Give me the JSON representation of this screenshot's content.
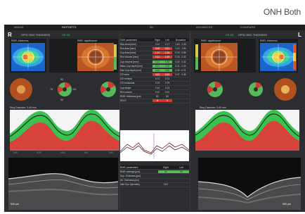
{
  "page": {
    "title": "ONH Both"
  },
  "tabs": [
    {
      "label": "IMAGE"
    },
    {
      "label": "REPORTS"
    },
    {
      "label": "3D"
    },
    {
      "label": "ADVANCED"
    },
    {
      "label": "COMPARE"
    }
  ],
  "eyes": {
    "right": "R",
    "left": "L"
  },
  "layer_buttons": {
    "right_label": "OPTIC DISC THICKNESS",
    "left_label": "OPTIC DISC THICKNESS",
    "right_toggle": "OD OS",
    "left_toggle": "OD OS"
  },
  "maps": {
    "right_thickness_title": "RNFL thickness",
    "right_significance_title": "RNFL significance",
    "left_significance_title": "RNFL significance",
    "left_thickness_title": "RNFL thickness"
  },
  "sector_labels": {
    "right_quadrant_values": [
      "93",
      "101",
      "50",
      "78"
    ],
    "left_quadrant_values": [
      "92",
      "102",
      "59",
      "81"
    ]
  },
  "ring_diameter": {
    "right": "Ring Diameter: 3.45 mm",
    "left": "Ring Diameter: 3.45 mm"
  },
  "onh_table": {
    "header": [
      "ONH parameters",
      "Right",
      "Left",
      "Normative"
    ],
    "rows": [
      {
        "label": "Disc Area [mm²]",
        "right": "2.11",
        "left": "2.17",
        "norm": "1.63 - 2.43",
        "rc": "n",
        "lc": "n"
      },
      {
        "label": "Rim Area [mm²]",
        "right": "0.99",
        "left": "0.91",
        "norm": "1.14 - 1.94",
        "rc": "r",
        "lc": "r"
      },
      {
        "label": "Cup Area [mm²]",
        "right": "1.12",
        "left": "1.26",
        "norm": "0.15 - 0.85",
        "rc": "r",
        "lc": "r"
      },
      {
        "label": "Rim Volume [mm³]",
        "right": "0.12",
        "left": "0.10",
        "norm": "0.16 - 0.40",
        "rc": "r",
        "lc": "r"
      },
      {
        "label": "Cup Volume [mm³]",
        "right": "0.31",
        "left": "0.36",
        "norm": "0.02 - 0.32",
        "rc": "g",
        "lc": "g"
      },
      {
        "label": "Mean Cup depth [mm]",
        "right": "0.27",
        "left": "0.29",
        "norm": "0.11 - 0.33",
        "rc": "g",
        "lc": "g"
      },
      {
        "label": "Max Cup depth [mm]",
        "right": "0.61",
        "left": "0.66",
        "norm": "0.29 - 0.71",
        "rc": "g",
        "lc": "g"
      },
      {
        "label": "C/D area",
        "right": "0.53",
        "left": "0.58",
        "norm": "0.07 - 0.45",
        "rc": "r",
        "lc": "r"
      },
      {
        "label": "C/D vertical",
        "right": "0.71",
        "left": "0.74",
        "norm": "",
        "rc": "n",
        "lc": "n"
      },
      {
        "label": "C/D horizontal",
        "right": "0.76",
        "left": "0.78",
        "norm": "",
        "rc": "n",
        "lc": "n"
      },
      {
        "label": "Cup shape",
        "right": "0.14",
        "left": "0.15",
        "norm": "",
        "rc": "n",
        "lc": "n"
      },
      {
        "label": "Rim volume",
        "right": "0.12",
        "left": "0.10",
        "norm": "",
        "rc": "n",
        "lc": "n"
      },
      {
        "label": "RNFL thickness [µm]",
        "right": "81",
        "left": "84",
        "norm": "",
        "rc": "n",
        "lc": "n"
      },
      {
        "label": "DDLS",
        "right": "8",
        "left": "9",
        "norm": "",
        "rc": "r",
        "lc": "r"
      }
    ]
  },
  "rnfl_table": {
    "header": [
      "RNFL parameters",
      "Right",
      "Left"
    ],
    "rows": [
      {
        "label": "RNFL average [µm]",
        "right": "81",
        "left": "84",
        "rc": "g",
        "lc": "g"
      },
      {
        "label": "Sup. Thickness [µm]",
        "right": "",
        "left": "",
        "rc": "n",
        "lc": "n"
      },
      {
        "label": "Inf. Thickness [µm]",
        "right": "",
        "left": "",
        "rc": "n",
        "lc": "n"
      },
      {
        "label": "Inter Eye Symmetry",
        "right": "0.87",
        "left": "",
        "rc": "n",
        "lc": "n"
      }
    ]
  },
  "scale_labels": {
    "right_oct_scale": "500 µm",
    "left_oct_scale": "500 µm",
    "axis_ticks": [
      "TMP",
      "SUP",
      "NAS",
      "INF",
      "TMP"
    ]
  },
  "colors": {
    "bg": "#2b2d30",
    "green": "#58b85c",
    "red": "#cf3b32",
    "yellow": "#d8c94c"
  }
}
